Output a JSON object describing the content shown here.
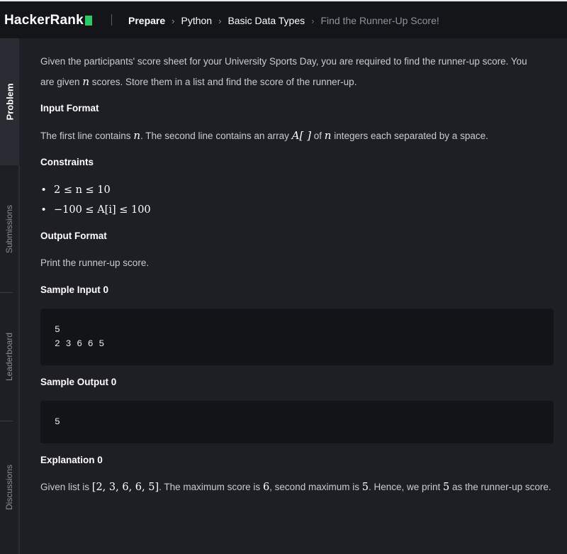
{
  "header": {
    "logo_text": "HackerRank",
    "breadcrumbs": [
      "Prepare",
      "Python",
      "Basic Data Types",
      "Find the Runner-Up Score!"
    ]
  },
  "sidebar": {
    "tabs": [
      "Problem",
      "Submissions",
      "Leaderboard",
      "Discussions"
    ]
  },
  "problem": {
    "intro_line1": "Given the participants' score sheet for your University Sports Day, you are required to find the runner-up score. You",
    "intro_line2_a": "are given",
    "intro_var": "n",
    "intro_line2_b": "scores. Store them in a list and find the score of the runner-up.",
    "input_format_heading": "Input Format",
    "input_a": "The first line contains",
    "input_n1": "n",
    "input_b": ". The second line contains an array",
    "input_arr": "A[ ]",
    "input_c": "of",
    "input_n2": "n",
    "input_d": "integers each separated by a space.",
    "constraints_heading": "Constraints",
    "constraints": [
      "2 ≤ n ≤ 10",
      "−100 ≤ A[i] ≤ 100"
    ],
    "output_format_heading": "Output Format",
    "output_text": "Print the runner-up score.",
    "sample_input_heading": "Sample Input 0",
    "sample_input_lines": [
      "5",
      "2 3 6 6 5"
    ],
    "sample_output_heading": "Sample Output 0",
    "sample_output_lines": [
      "5"
    ],
    "explanation_heading": "Explanation 0",
    "expl_a": "Given list is",
    "expl_list": "[2, 3, 6, 6, 5]",
    "expl_b": ". The maximum score is",
    "expl_max": "6",
    "expl_c": ", second maximum is",
    "expl_second": "5",
    "expl_d": ". Hence, we print",
    "expl_print": "5",
    "expl_e": "as the runner-up score."
  },
  "colors": {
    "background": "#1e1f25",
    "topbar": "#141519",
    "brand_green": "#2ec866",
    "code_bg": "#131418"
  }
}
